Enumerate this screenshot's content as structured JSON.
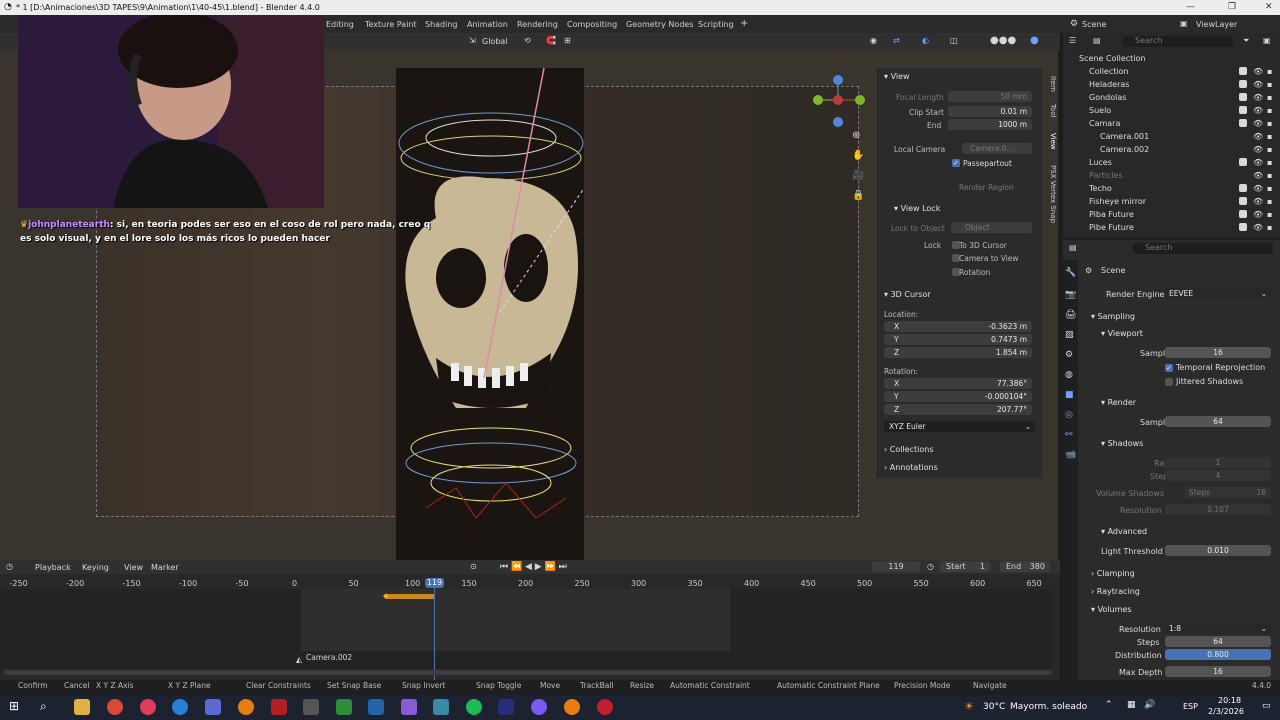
{
  "window": {
    "title": "* 1 [D:\\Animaciones\\3D TAPES\\9\\Animation\\1\\40-45\\1.blend] - Blender 4.4.0"
  },
  "workspaces": [
    "Editing",
    "Texture Paint",
    "Shading",
    "Animation",
    "Rendering",
    "Compositing",
    "Geometry Nodes",
    "Scripting"
  ],
  "top_right": {
    "scene": "Scene",
    "view_layer": "ViewLayer"
  },
  "viewport_header": {
    "orientation": "Global"
  },
  "chat": {
    "user": "johnplanetearth",
    "message": "si, en teoria podes ser eso en el coso de rol pero nada, creo q es solo visual, y en el lore solo los más ricos lo pueden hacer"
  },
  "npanel": {
    "tabs": [
      "Item",
      "Tool",
      "View",
      "PSX Vertex Snap"
    ],
    "view": {
      "title": "View",
      "focal_length_label": "Focal Length",
      "focal_length": "50 mm",
      "clip_start_label": "Clip Start",
      "clip_start": "0.01 m",
      "end_label": "End",
      "end": "1000 m",
      "local_camera_label": "Local Camera",
      "local_camera": "Camera.0...",
      "passepartout": "Passepartout",
      "render_region": "Render Region"
    },
    "view_lock": {
      "title": "View Lock",
      "lock_to_object": "Lock to Object",
      "object_ph": "Object",
      "lock_label": "Lock",
      "to_3d_cursor": "To 3D Cursor",
      "camera_to_view": "Camera to View",
      "rotation": "Rotation"
    },
    "cursor": {
      "title": "3D Cursor",
      "location": "Location:",
      "x": "-0.3623 m",
      "y": "0.7473 m",
      "z": "1.854 m",
      "rotation": "Rotation:",
      "rx": "77.386°",
      "ry": "-0.000104°",
      "rz": "207.77°",
      "mode": "XYZ Euler",
      "X": "X",
      "Y": "Y",
      "Z": "Z"
    },
    "collections": "Collections",
    "annotations": "Annotations"
  },
  "outliner": {
    "search": "Search",
    "rows": [
      {
        "name": "Scene Collection"
      },
      {
        "name": "Collection"
      },
      {
        "name": "Heladeras"
      },
      {
        "name": "Gondolas"
      },
      {
        "name": "Suelo"
      },
      {
        "name": "Camara"
      },
      {
        "name": "Camera.001"
      },
      {
        "name": "Camera.002"
      },
      {
        "name": "Luces"
      },
      {
        "name": "Particles"
      },
      {
        "name": "Techo"
      },
      {
        "name": "Fisheye mirror"
      },
      {
        "name": "Piba Future"
      },
      {
        "name": "Pibe Future"
      }
    ]
  },
  "props": {
    "search": "Search",
    "scene": "Scene",
    "render_engine_label": "Render Engine",
    "render_engine": "EEVEE",
    "sampling": "Sampling",
    "viewport": "Viewport",
    "samples_label": "Samples",
    "viewport_samples": "16",
    "temporal": "Temporal Reprojection",
    "jittered": "Jittered Shadows",
    "render": "Render",
    "render_samples": "64",
    "shadows": "Shadows",
    "rays_label": "Rays",
    "rays": "1",
    "steps_label": "Steps",
    "steps": "4",
    "vol_shadows": "Volume Shadows",
    "vol_steps_label": "Steps",
    "vol_steps": "16",
    "resolution_label": "Resolution",
    "resolution": "0.107",
    "advanced": "Advanced",
    "light_threshold_label": "Light Threshold",
    "light_threshold": "0.010",
    "clamping": "Clamping",
    "raytracing": "Raytracing",
    "volumes": "Volumes",
    "vol_resolution_label": "Resolution",
    "vol_resolution": "1:8",
    "vol_steps2_label": "Steps",
    "vol_steps2": "64",
    "distribution_label": "Distribution",
    "distribution": "0.800",
    "max_depth_label": "Max Depth",
    "max_depth": "16"
  },
  "timeline": {
    "menus": [
      "Playback",
      "Keying",
      "View",
      "Marker"
    ],
    "current_frame": "119",
    "start_label": "Start",
    "start": "1",
    "end_label": "End",
    "end": "380",
    "ticks": [
      "-250",
      "-200",
      "-150",
      "-100",
      "-50",
      "0",
      "50",
      "100",
      "150",
      "200",
      "250",
      "300",
      "350",
      "400",
      "450",
      "500",
      "550",
      "600",
      "650"
    ],
    "camera_marker": "Camera.002"
  },
  "statusbar": {
    "items": [
      "Confirm",
      "Cancel",
      "X Y Z Axis",
      "X Y Z Plane",
      "Clear Constraints",
      "Set Snap Base",
      "Snap Invert",
      "Snap Toggle",
      "Move",
      "TrackBall",
      "Resize",
      "Automatic Constraint",
      "Automatic Constraint Plane",
      "Precision Mode",
      "Navigate"
    ],
    "version": "4.4.0"
  },
  "taskbar": {
    "weather": "30°C",
    "weather_desc": "Mayorm. soleado",
    "lang": "ESP",
    "time": "20:18",
    "date": "2/3/2026"
  },
  "colors": {
    "accent": "#4772b3",
    "bg": "#1d1d1d"
  }
}
